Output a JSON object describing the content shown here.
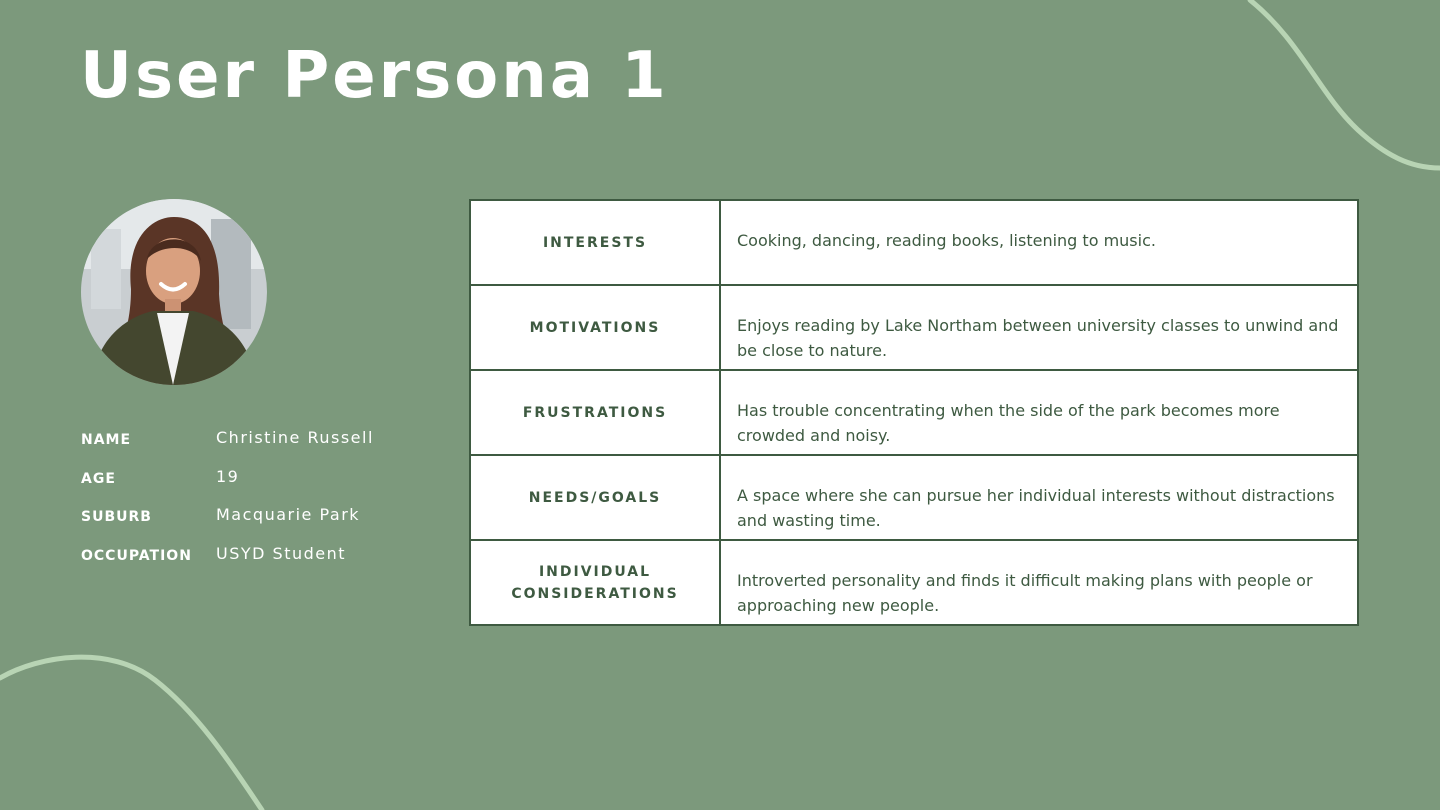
{
  "title": "User Persona 1",
  "profile": {
    "name_label": "NAME",
    "name_value": "Christine Russell",
    "age_label": "AGE",
    "age_value": "19",
    "suburb_label": "SUBURB",
    "suburb_value": "Macquarie Park",
    "occupation_label": "OCCUPATION",
    "occupation_value": "USYD Student"
  },
  "table": {
    "rows": [
      {
        "label": "INTERESTS",
        "text": "Cooking, dancing, reading books, listening to music."
      },
      {
        "label": "MOTIVATIONS",
        "text": "Enjoys reading by Lake Northam between university classes to unwind and be close to nature."
      },
      {
        "label": "FRUSTRATIONS",
        "text": "Has trouble concentrating when the side of the park becomes more crowded and noisy."
      },
      {
        "label": "NEEDS/GOALS",
        "text": "A space where she can pursue her individual interests without distractions and wasting time."
      },
      {
        "label": "INDIVIDUAL CONSIDERATIONS",
        "text": "Introverted personality and finds it difficult making plans with people or approaching new people."
      }
    ]
  },
  "colors": {
    "background": "#7c997c",
    "curve": "#b8d4b4",
    "table_border": "#3e5a41",
    "table_text": "#3e5a41",
    "heading_text": "#ffffff"
  }
}
